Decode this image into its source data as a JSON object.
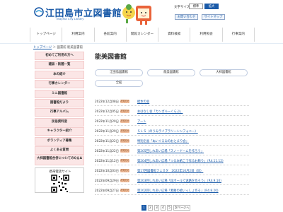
{
  "header": {
    "logo_title": "江田島市立図書館",
    "logo_subtitle": "Etajima City Library",
    "text_size_label": "文字サイズ",
    "text_size_standard": "標準",
    "text_size_large": "拡大",
    "contact_label": "お問い合わせ",
    "sitemap_label": "サイトマップ",
    "accent_color": "#1a5aa8"
  },
  "gnav": [
    {
      "label": "トップページ"
    },
    {
      "label": "利用案内"
    },
    {
      "label": "各館案内"
    },
    {
      "label": "開館カレンダー"
    },
    {
      "label": "資料検索"
    },
    {
      "label": "利用照会"
    },
    {
      "label": "行事案内"
    }
  ],
  "breadcrumb": {
    "home": "トップページ",
    "separator": " ＞ ",
    "current": "図書館 能美図書館"
  },
  "sidebar": {
    "items": [
      {
        "label": "初めてご利用の方へ"
      },
      {
        "label": "雑誌・新聞一覧"
      },
      {
        "label": "本の紹介"
      },
      {
        "label": "行事カレンダー"
      },
      {
        "label": "ミニ図書館"
      },
      {
        "label": "図書館だより"
      },
      {
        "label": "行事アルバム"
      },
      {
        "label": "民俗資料室"
      },
      {
        "label": "キャラクター紹介"
      },
      {
        "label": "ボランティア募集"
      },
      {
        "label": "よくある質問"
      },
      {
        "label": "大柿図書館合併についてのQ＆A"
      }
    ],
    "phone_site_label": "携帯電話サイト"
  },
  "main": {
    "title": "能美図書館",
    "filters": [
      {
        "label": "江田島図書館"
      },
      {
        "label": "能美図書館"
      },
      {
        "label": "大柿図書館"
      },
      {
        "label": "全館"
      }
    ],
    "news": [
      {
        "date": "2022年12月08日",
        "badge": "お知らせ",
        "title": "絵本の会"
      },
      {
        "date": "2022年12月05日",
        "badge": "お知らせ",
        "title": "おはなし会「カンガルーくらぶ」"
      },
      {
        "date": "2022年11月20日",
        "badge": "お知らせ",
        "title": "アート"
      },
      {
        "date": "2022年11月29日",
        "badge": "お知らせ",
        "title": "ＳＬＳ（のうみライブラリーシンフォニー）"
      },
      {
        "date": "2022年11月22日",
        "badge": "お知らせ",
        "title": "特別企画「ぬいぐるみのおとまり会」"
      },
      {
        "date": "2022年11月22日",
        "badge": "お知らせ",
        "title": "第205回しれあい広場「スノードームを作ろう」"
      },
      {
        "date": "2022年11月12日",
        "badge": "お知らせ",
        "title": "第204回しれあい広場「つるみ紙こで作るお飾り」（R4.11.12)"
      },
      {
        "date": "2022年10月03日",
        "badge": "お知らせ",
        "title": "第17回図書館フェスタ　2022年10月2日（日）"
      },
      {
        "date": "2022年09月29日",
        "badge": "お知らせ",
        "title": "第203回しれあい広場「段ボールで迷路を作ろう」（R4.9.10)"
      },
      {
        "date": "2022年09月27日",
        "badge": "お知らせ",
        "title": "第202回しれあい広場「素敵の絵いっしょ作る」（R4.8.20)"
      }
    ],
    "pager": {
      "pages": [
        "1",
        "2",
        "3",
        "4",
        "5"
      ],
      "current": "1",
      "next_label": "次ページへ"
    }
  }
}
